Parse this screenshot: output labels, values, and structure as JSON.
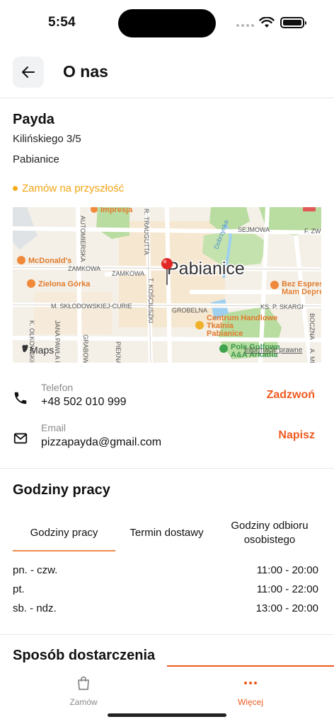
{
  "status_bar": {
    "time": "5:54"
  },
  "header": {
    "title": "O nas"
  },
  "restaurant": {
    "name": "Payda",
    "address_line1": "Kilińskiego 3/5",
    "address_line2": "Pabianice",
    "future_order": "Zamów na przyszłość"
  },
  "map": {
    "city_label": "Pabianice",
    "attribution": "Maps",
    "legal": "Informacje prawne",
    "pois": [
      "Impresja",
      "McDonald's",
      "Zielona Górka",
      "Bez Espresso",
      "Mam Depresji",
      "Centrum Handlowe",
      "Tkalnia",
      "Pabianice",
      "Pole Golfowe",
      "A&A Arkadia"
    ],
    "streets": [
      "AUTOMIERSKA",
      "R. TRAUGUTTA",
      "SEJMOWA",
      "F. ZWI",
      "ZAMKOWA",
      "ZAMKOWA",
      "T. KOŚCIUSZKI",
      "M. SKŁODOWSKIEJ-CURIE",
      "GROBELNA",
      "KS. P. SKARGI",
      "Dobrzynka",
      "K. OLKOWSKIEGO",
      "JANA PAWŁA II",
      "GRABOWA",
      "PIEKNA",
      "BOCZNA",
      "A. MI"
    ]
  },
  "contacts": [
    {
      "label": "Telefon",
      "value": "+48 502 010 999",
      "action": "Zadzwoń"
    },
    {
      "label": "Email",
      "value": "pizzapayda@gmail.com",
      "action": "Napisz"
    }
  ],
  "hours_section": {
    "title": "Godziny pracy",
    "tabs": [
      "Godziny pracy",
      "Termin dostawy",
      "Godziny odbioru\nosobistego"
    ],
    "rows": [
      {
        "days": "pn. - czw.",
        "time": "11:00 - 20:00"
      },
      {
        "days": "pt.",
        "time": "11:00 - 22:00"
      },
      {
        "days": "sb. - ndz.",
        "time": "13:00 - 20:00"
      }
    ]
  },
  "delivery_section": {
    "title": "Sposób dostarczenia"
  },
  "bottom_nav": {
    "items": [
      {
        "label": "Zamów",
        "icon": "bag-icon"
      },
      {
        "label": "Więcej",
        "icon": "more-dots-icon"
      }
    ]
  },
  "colors": {
    "accent": "#ee5a1f",
    "future": "#f2a413",
    "muted": "#8a8a8a"
  }
}
